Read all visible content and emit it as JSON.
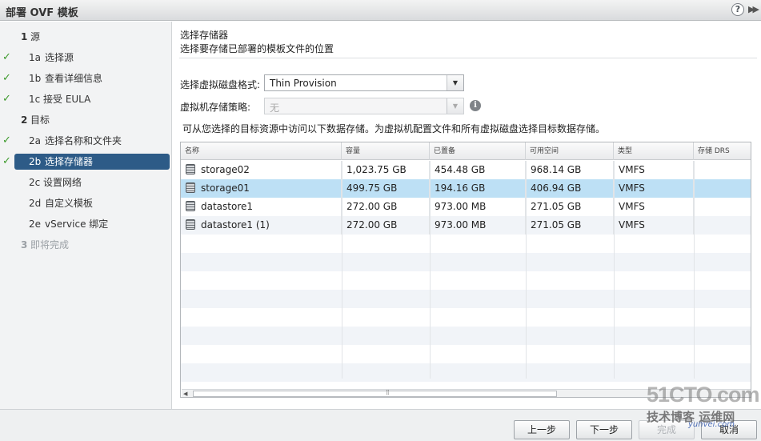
{
  "window": {
    "title": "部署 OVF 模板"
  },
  "nav": {
    "items": [
      {
        "num": "1",
        "label": "源",
        "done": false,
        "state": "section"
      },
      {
        "num": "1a",
        "label": "选择源",
        "done": true,
        "state": "step"
      },
      {
        "num": "1b",
        "label": "查看详细信息",
        "done": true,
        "state": "step"
      },
      {
        "num": "1c",
        "label": "接受 EULA",
        "done": true,
        "state": "step"
      },
      {
        "num": "2",
        "label": "目标",
        "done": false,
        "state": "section"
      },
      {
        "num": "2a",
        "label": "选择名称和文件夹",
        "done": true,
        "state": "step"
      },
      {
        "num": "2b",
        "label": "选择存储器",
        "done": true,
        "state": "selected"
      },
      {
        "num": "2c",
        "label": "设置网络",
        "done": false,
        "state": "step"
      },
      {
        "num": "2d",
        "label": "自定义模板",
        "done": false,
        "state": "step"
      },
      {
        "num": "2e",
        "label": "vService 绑定",
        "done": false,
        "state": "step"
      },
      {
        "num": "3",
        "label": "即将完成",
        "done": false,
        "state": "disabled"
      }
    ]
  },
  "header": {
    "title": "选择存储器",
    "subtitle": "选择要存储已部署的模板文件的位置"
  },
  "form": {
    "disk_format_label": "选择虚拟磁盘格式:",
    "disk_format_value": "Thin Provision",
    "policy_label": "虚拟机存储策略:",
    "policy_value": "无",
    "description": "可从您选择的目标资源中访问以下数据存储。为虚拟机配置文件和所有虚拟磁盘选择目标数据存储。"
  },
  "table": {
    "columns": [
      "名称",
      "容量",
      "已置备",
      "可用空间",
      "类型",
      "存储 DRS"
    ],
    "rows": [
      {
        "name": "storage02",
        "capacity": "1,023.75 GB",
        "provisioned": "454.48 GB",
        "free": "968.14 GB",
        "type": "VMFS",
        "drs": ""
      },
      {
        "name": "storage01",
        "capacity": "499.75 GB",
        "provisioned": "194.16 GB",
        "free": "406.94 GB",
        "type": "VMFS",
        "drs": ""
      },
      {
        "name": "datastore1",
        "capacity": "272.00 GB",
        "provisioned": "973.00 MB",
        "free": "271.05 GB",
        "type": "VMFS",
        "drs": ""
      },
      {
        "name": "datastore1 (1)",
        "capacity": "272.00 GB",
        "provisioned": "973.00 MB",
        "free": "271.05 GB",
        "type": "VMFS",
        "drs": ""
      }
    ],
    "selected_row": 1
  },
  "footer": {
    "back_label": "上一步",
    "next_label": "下一步",
    "finish_label": "完成",
    "cancel_label": "取消"
  },
  "watermark": {
    "line1": "51CTO.com",
    "line2": "技术博客",
    "line2b": "运维网",
    "line3": "yunvei.com"
  },
  "colors": {
    "selected_nav": "#2d5b87",
    "selected_row": "#bde0f5",
    "check": "#3d9a2b"
  }
}
